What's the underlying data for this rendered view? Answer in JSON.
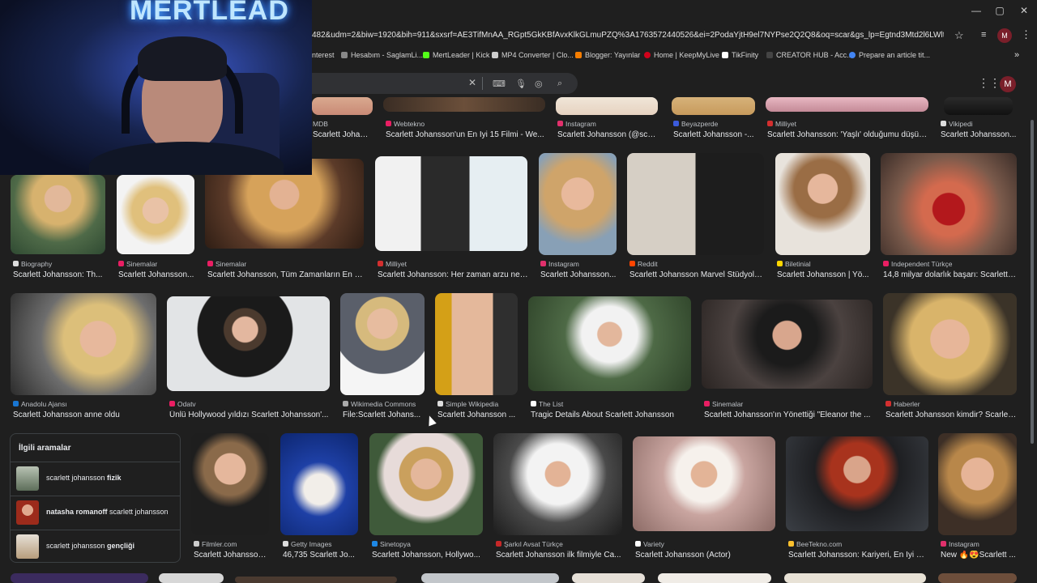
{
  "browser": {
    "url": "482&udm=2&biw=1920&bih=911&sxsrf=AE3TifMnAA_RGpt5GkKBfAvxKlkGLmuPZQ%3A1763572440526&ei=2PodaYjtH9el7NYPse2Q2Q8&oq=scar&gs_lp=Egtnd3Mtd2l6LWltZyIEc2Nhcio...",
    "profile_initial": "M",
    "window_controls": [
      "—",
      "▢",
      "✕"
    ]
  },
  "bookmarks": [
    {
      "label": "nterest",
      "color": "#e60023"
    },
    {
      "label": "Hesabım - SaglamLi...",
      "color": "#888888"
    },
    {
      "label": "MertLeader | Kick",
      "color": "#53fc18"
    },
    {
      "label": "MP4 Converter | Clo...",
      "color": "#cccccc"
    },
    {
      "label": "Blogger: Yayınlar",
      "color": "#f57d00"
    },
    {
      "label": "Home | KeepMyLive",
      "color": "#d0021b"
    },
    {
      "label": "TikFinity",
      "color": "#ffffff"
    },
    {
      "label": "CREATOR HUB - Acc...",
      "color": "#222222"
    },
    {
      "label": "Prepare an article tit...",
      "color": "#4285f4"
    }
  ],
  "overlay": {
    "brand_text": "MERTLEAD"
  },
  "row0": [
    {
      "source": "MDB",
      "title": "Scarlett Johansson...",
      "fav": "#f5c518"
    },
    {
      "source": "Webtekno",
      "title": "Scarlett Johansson'un En İyi 15 Filmi - We...",
      "fav": "#e91e63"
    },
    {
      "source": "Instagram",
      "title": "Scarlett Johansson (@sca...",
      "fav": "#e1306c"
    },
    {
      "source": "Beyazperde",
      "title": "Scarlett Johansson -...",
      "fav": "#3b5bdb"
    },
    {
      "source": "Milliyet",
      "title": "Scarlett Johansson: 'Yaşlı' olduğumu düşün...",
      "fav": "#d32f2f"
    },
    {
      "source": "Vikipedi",
      "title": "Scarlett Johansson...",
      "fav": "#dddddd"
    }
  ],
  "row1": [
    {
      "source": "Biography",
      "title": "Scarlett Johansson: Th...",
      "fav": "#dddddd"
    },
    {
      "source": "Sinemalar",
      "title": "Scarlett Johansson...",
      "fav": "#e91e63"
    },
    {
      "source": "Sinemalar",
      "title": "Scarlett Johansson, Tüm Zamanların En Ç...",
      "fav": "#e91e63"
    },
    {
      "source": "Milliyet",
      "title": "Scarlett Johansson: Her zaman arzu nes...",
      "fav": "#d32f2f"
    },
    {
      "source": "Instagram",
      "title": "Scarlett Johansson...",
      "fav": "#e1306c"
    },
    {
      "source": "Reddit",
      "title": "Scarlett Johansson Marvel Stüdyola...",
      "fav": "#ff4500"
    },
    {
      "source": "Biletinial",
      "title": "Scarlett Johansson | Yö...",
      "fav": "#ffd600"
    },
    {
      "source": "Independent Türkçe",
      "title": "14,8 milyar dolarlık başarı: Scarlett ...",
      "fav": "#e91e63"
    }
  ],
  "row2": [
    {
      "source": "Anadolu Ajansı",
      "title": "Scarlett Johansson anne oldu",
      "fav": "#1976d2"
    },
    {
      "source": "Odatv",
      "title": "Ünlü Hollywood yıldızı Scarlett Johansson'...",
      "fav": "#e91e63"
    },
    {
      "source": "Wikimedia Commons",
      "title": "File:Scarlett Johans...",
      "fav": "#aaaaaa"
    },
    {
      "source": "Simple Wikipedia",
      "title": "Scarlett Johansson ...",
      "fav": "#dddddd"
    },
    {
      "source": "The List",
      "title": "Tragic Details About Scarlett Johansson",
      "fav": "#ffffff"
    },
    {
      "source": "Sinemalar",
      "title": "Scarlett Johansson'ın Yönettiği \"Eleanor the ...",
      "fav": "#e91e63"
    },
    {
      "source": "Haberler",
      "title": "Scarlett Johansson kimdir? Scarlet...",
      "fav": "#d32f2f"
    }
  ],
  "related": {
    "heading": "İlgili aramalar",
    "items": [
      {
        "prefix": "scarlett johansson ",
        "bold": "fizik",
        "suffix": ""
      },
      {
        "prefix": "",
        "bold": "natasha romanoff",
        "suffix": " scarlett johansson"
      },
      {
        "prefix": "scarlett johansson ",
        "bold": "gençliği",
        "suffix": ""
      }
    ]
  },
  "row3": [
    {
      "source": "Filmler.com",
      "title": "Scarlett Johansson...",
      "fav": "#cccccc"
    },
    {
      "source": "Getty Images",
      "title": "46,735 Scarlett Jo...",
      "fav": "#dddddd"
    },
    {
      "source": "Sinetopya",
      "title": "Scarlett Johansson, Hollywo...",
      "fav": "#1e88e5"
    },
    {
      "source": "Şarkıl Avsat Türkçe",
      "title": "Scarlett Johansson ilk filmiyle Ca...",
      "fav": "#c62828"
    },
    {
      "source": "Variety",
      "title": "Scarlett Johansson (Actor)",
      "fav": "#ffffff"
    },
    {
      "source": "BeeTekno.com",
      "title": "Scarlett Johansson: Kariyeri, En İyi Fi...",
      "fav": "#fbc02d"
    },
    {
      "source": "Instagram",
      "title": "New 🔥😍Scarlett ...",
      "fav": "#e1306c"
    }
  ]
}
